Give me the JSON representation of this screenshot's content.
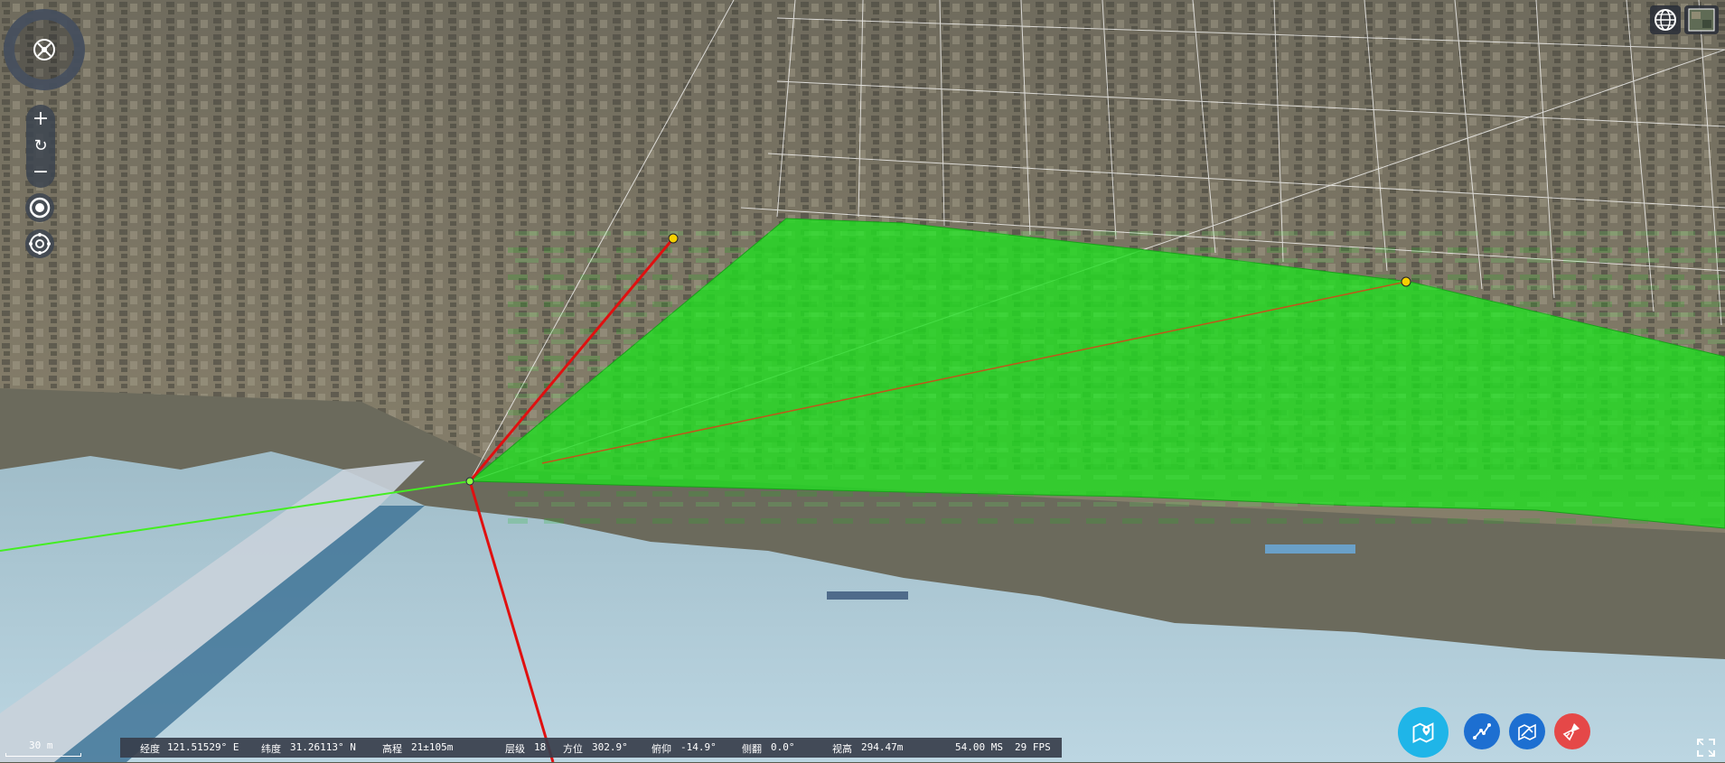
{
  "status": {
    "lon_label": "经度",
    "lon_value": "121.51529° E",
    "lat_label": "纬度",
    "lat_value": "31.26113° N",
    "alt_label": "高程",
    "alt_value": "21±105m",
    "level_label": "层级",
    "level_value": "18",
    "heading_label": "方位",
    "heading_value": "302.9°",
    "pitch_label": "俯仰",
    "pitch_value": "-14.9°",
    "roll_label": "侧翻",
    "roll_value": "0.0°",
    "view_label": "视高",
    "view_value": "294.47m",
    "ms": "54.00 MS",
    "fps": "29 FPS"
  },
  "scale": {
    "label": "30 m"
  },
  "colors": {
    "polygon": "#22dd22",
    "line_red": "#e01010",
    "line_green": "#44ee22",
    "tool_cyan": "#1fb5e8",
    "tool_blue": "#1d6fd1",
    "tool_red": "#e54848"
  },
  "icons": {
    "navigator": "compass-icon",
    "zoom_in": "plus-icon",
    "reset": "refresh-icon",
    "zoom_out": "minus-icon",
    "locate": "locate-icon",
    "orbit": "orbit-icon",
    "globe": "globe-icon",
    "layers": "basemap-icon",
    "tool1": "map-pin-icon",
    "tool2": "polyline-icon",
    "tool3": "area-icon",
    "tool4": "clear-icon",
    "fullscreen": "fullscreen-icon"
  }
}
